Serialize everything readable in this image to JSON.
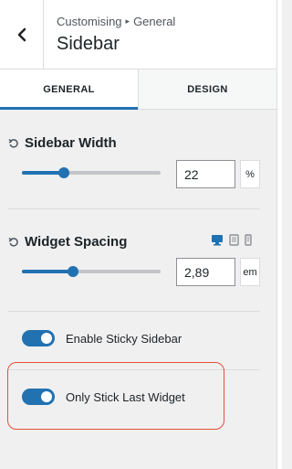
{
  "header": {
    "breadcrumb": [
      "Customising",
      "General"
    ],
    "breadcrumb_separator": "▸",
    "title": "Sidebar",
    "back_icon": "chevron-left-icon"
  },
  "tabs": [
    {
      "label": "GENERAL",
      "active": true
    },
    {
      "label": "DESIGN",
      "active": false
    }
  ],
  "sidebar_width": {
    "label": "Sidebar Width",
    "value": "22",
    "unit": "%",
    "slider_fraction": 0.3
  },
  "widget_spacing": {
    "label": "Widget Spacing",
    "value": "2,89",
    "unit": "em",
    "slider_fraction": 0.37,
    "devices": [
      "desktop-icon",
      "tablet-icon",
      "mobile-icon"
    ],
    "active_device": "desktop-icon"
  },
  "toggles": [
    {
      "label": "Enable Sticky Sidebar",
      "on": true
    },
    {
      "label": "Only Stick Last Widget",
      "on": true
    }
  ],
  "colors": {
    "accent": "#2271b1",
    "highlight": "#e2503a"
  }
}
